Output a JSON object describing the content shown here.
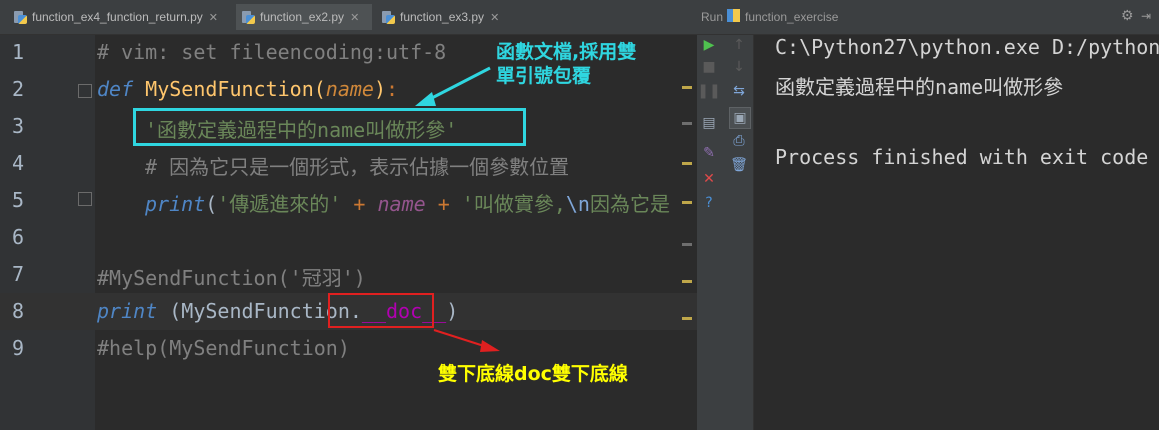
{
  "tabs": [
    {
      "label": "function_ex4_function_return.py",
      "active": false
    },
    {
      "label": "function_ex2.py",
      "active": true
    },
    {
      "label": "function_ex3.py",
      "active": false
    }
  ],
  "run_header": {
    "run_label": "Run",
    "config_name": "function_exercise"
  },
  "editor": {
    "line_numbers": [
      "1",
      "2",
      "3",
      "4",
      "5",
      "6",
      "7",
      "8",
      "9"
    ],
    "line1": "# vim: set fileencoding:utf-8",
    "line2": {
      "def": "def",
      "name": "MySendFunction",
      "lparen": "(",
      "param": "name",
      "rparen": ")",
      "colon": ":"
    },
    "line3": "'函數定義過程中的name叫做形參'",
    "line4": "# 因為它只是一個形式，表示佔據一個參數位置",
    "line5": {
      "print": "print",
      "lparen": "(",
      "s1": "'傳遞進來的'",
      "plus1": " + ",
      "var": "name",
      "plus2": " + ",
      "s2a": "'叫做實參,",
      "esc": "\\n",
      "s2b": "因為它是"
    },
    "line7": "#MySendFunction('冠羽')",
    "line8": {
      "print": "print",
      "rest": " (MySendFunction.",
      "doc": "__doc__",
      "close": ")"
    },
    "line9": "#help(MySendFunction)"
  },
  "annotations": {
    "docstring_note_line1": "函數文檔,採用雙",
    "docstring_note_line2": "單引號包覆",
    "doc_note": "雙下底線doc雙下底線",
    "cyan": "#2fd6e0",
    "red": "#e02020",
    "doc_note_color": "#ffff00"
  },
  "console": {
    "line1": "C:\\Python27\\python.exe D:/python",
    "line2": "函數定義過程中的name叫做形參",
    "line3": "Process finished with exit code"
  }
}
